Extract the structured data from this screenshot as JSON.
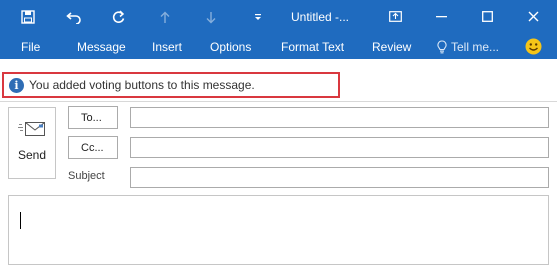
{
  "window": {
    "title": "Untitled -...",
    "title_bar_color": "#1f6bbf"
  },
  "quick_access": [
    "save-icon",
    "undo-icon",
    "redo-icon",
    "up-arrow-icon",
    "down-arrow-icon",
    "customize-dropdown-icon"
  ],
  "window_controls": [
    "ribbon-display-icon",
    "minimize-icon",
    "maximize-icon",
    "close-icon"
  ],
  "ribbon": {
    "tabs": [
      "File",
      "Message",
      "Insert",
      "Options",
      "Format Text",
      "Review"
    ],
    "tell_me": "Tell me...",
    "feedback_icon": "smiley-icon"
  },
  "infobar": {
    "text": "You added voting buttons to this message.",
    "highlight_color": "#d9383f"
  },
  "compose": {
    "send_label": "Send",
    "to_label": "To...",
    "cc_label": "Cc...",
    "subject_label": "Subject",
    "to_value": "",
    "cc_value": "",
    "subject_value": "",
    "body_value": ""
  }
}
